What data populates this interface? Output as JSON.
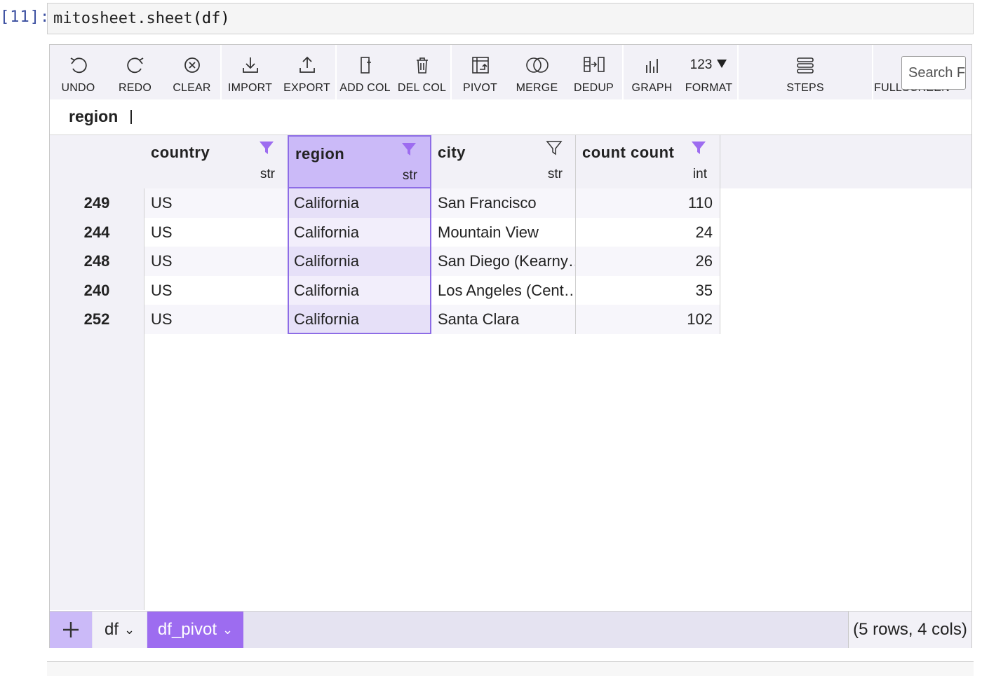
{
  "notebook": {
    "prompt": "[11]:",
    "code_fn": "mitosheet.sheet",
    "code_args": "(df)"
  },
  "toolbar": {
    "buttons": [
      {
        "label": "UNDO",
        "icon": "undo-icon"
      },
      {
        "label": "REDO",
        "icon": "redo-icon"
      },
      {
        "label": "CLEAR",
        "icon": "clear-icon"
      },
      {
        "label": "IMPORT",
        "icon": "import-icon"
      },
      {
        "label": "EXPORT",
        "icon": "export-icon"
      },
      {
        "label": "ADD COL",
        "icon": "add-column-icon"
      },
      {
        "label": "DEL COL",
        "icon": "delete-column-icon"
      },
      {
        "label": "PIVOT",
        "icon": "pivot-icon"
      },
      {
        "label": "MERGE",
        "icon": "merge-icon"
      },
      {
        "label": "DEDUP",
        "icon": "dedup-icon"
      },
      {
        "label": "GRAPH",
        "icon": "graph-icon"
      },
      {
        "label": "FORMAT",
        "icon": "format-icon",
        "text": "123"
      },
      {
        "label": "STEPS",
        "icon": "steps-icon"
      },
      {
        "label": "FULLSCREEN",
        "icon": "fullscreen-icon"
      }
    ],
    "search_placeholder": "Search F"
  },
  "formula_bar": {
    "selected_column": "region"
  },
  "columns": [
    {
      "name": "country",
      "dtype": "str",
      "filter_active": true
    },
    {
      "name": "region",
      "dtype": "str",
      "filter_active": true,
      "selected": true
    },
    {
      "name": "city",
      "dtype": "str",
      "filter_active": false
    },
    {
      "name": "count count",
      "dtype": "int",
      "filter_active": true
    }
  ],
  "rows": [
    {
      "index": "249",
      "country": "US",
      "region": "California",
      "city": "San Francisco",
      "count": "110"
    },
    {
      "index": "244",
      "country": "US",
      "region": "California",
      "city": "Mountain View",
      "count": "24"
    },
    {
      "index": "248",
      "country": "US",
      "region": "California",
      "city": "San Diego (Kearny…",
      "count": "26"
    },
    {
      "index": "240",
      "country": "US",
      "region": "California",
      "city": "Los Angeles (Cent…",
      "count": "35"
    },
    {
      "index": "252",
      "country": "US",
      "region": "California",
      "city": "Santa Clara",
      "count": "102"
    }
  ],
  "sheets": {
    "tabs": [
      {
        "label": "df",
        "active": false
      },
      {
        "label": "df_pivot",
        "active": true
      }
    ],
    "status": "(5 rows, 4 cols)"
  },
  "colors": {
    "accent": "#9d6cf0",
    "selected_header": "#cbbaf8",
    "toolbar_bg": "#f2f1f7"
  }
}
